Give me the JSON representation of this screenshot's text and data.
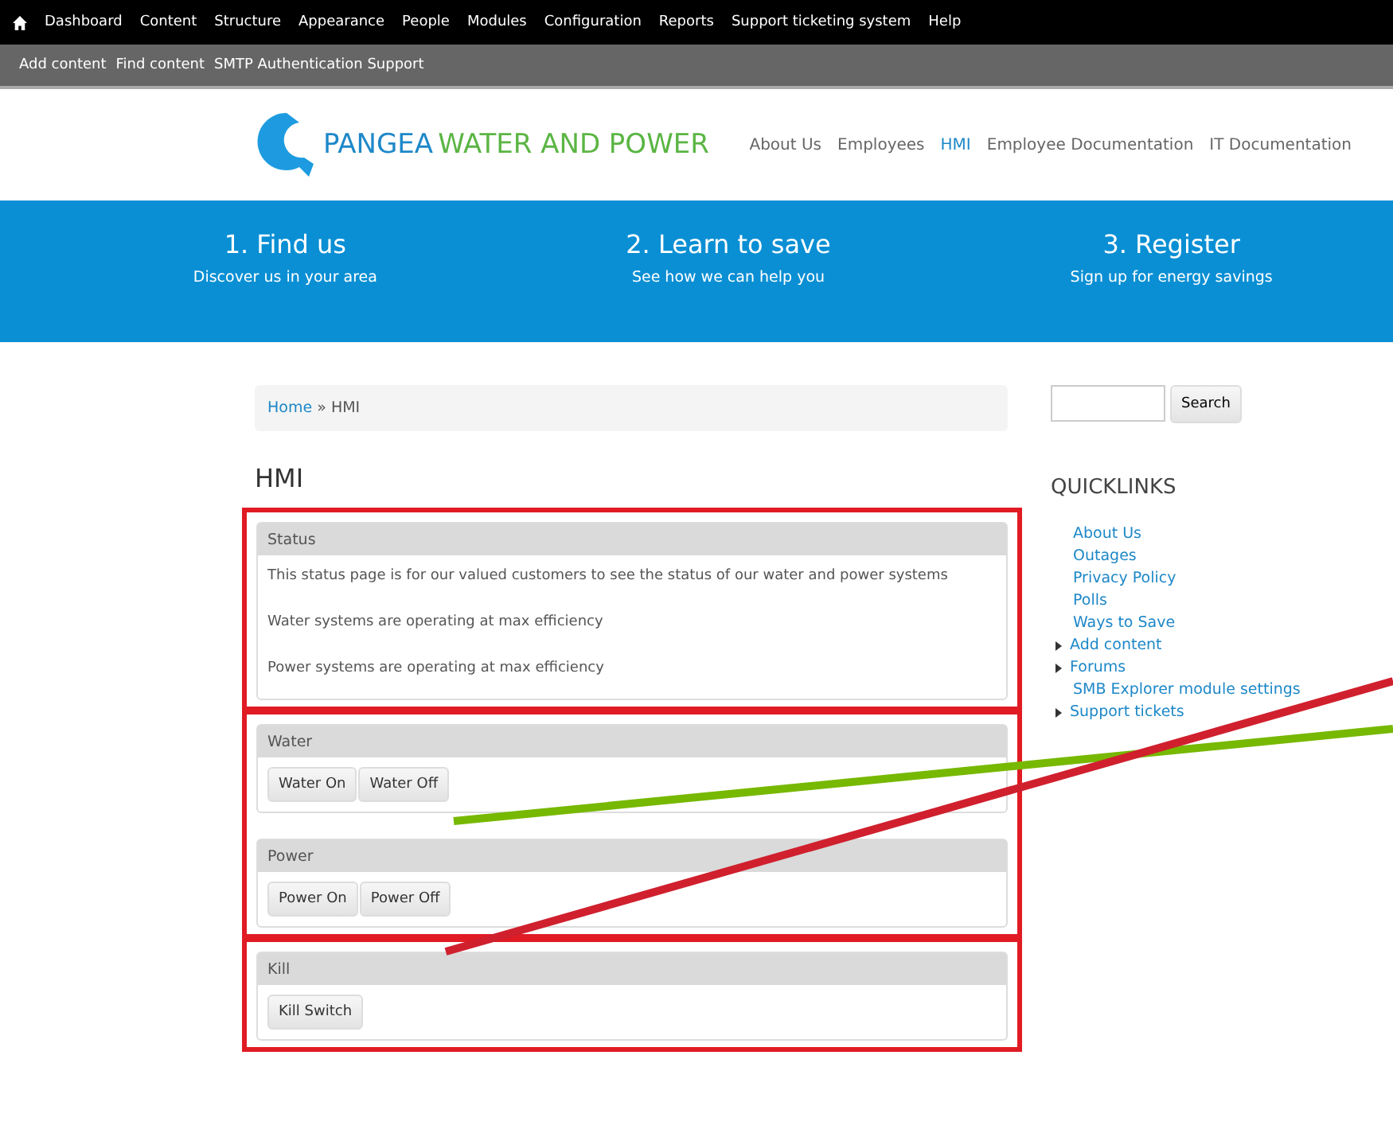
{
  "admin_toolbar": {
    "items": [
      "Dashboard",
      "Content",
      "Structure",
      "Appearance",
      "People",
      "Modules",
      "Configuration",
      "Reports",
      "Support ticketing system",
      "Help"
    ]
  },
  "shortcuts": [
    "Add content",
    "Find content",
    "SMTP Authentication Support"
  ],
  "header": {
    "logo_name": "PANGEA",
    "logo_tagline": "WATER AND POWER",
    "nav": [
      {
        "label": "About Us",
        "selected": false
      },
      {
        "label": "Employees",
        "selected": false
      },
      {
        "label": "HMI",
        "selected": true
      },
      {
        "label": "Employee Documentation",
        "selected": false
      },
      {
        "label": "IT Documentation",
        "selected": false
      }
    ]
  },
  "hero": [
    {
      "title": "1. Find us",
      "subtitle": "Discover us in your area"
    },
    {
      "title": "2. Learn to save",
      "subtitle": "See how we can help you"
    },
    {
      "title": "3. Register",
      "subtitle": "Sign up for energy savings"
    }
  ],
  "breadcrumb": {
    "link": "Home",
    "separator": "»",
    "current": "HMI"
  },
  "page_title": "HMI",
  "groups": [
    {
      "panels": [
        {
          "title": "Status",
          "kind": "text",
          "lines": [
            "This status page is for our valued customers to see the status of our water and power systems",
            "Water systems are operating at max efficiency",
            "Power systems are operating at max efficiency"
          ]
        }
      ]
    },
    {
      "panels": [
        {
          "title": "Water",
          "kind": "buttons",
          "buttons": [
            "Water On",
            "Water Off"
          ]
        },
        {
          "title": "Power",
          "kind": "buttons",
          "buttons": [
            "Power On",
            "Power Off"
          ]
        }
      ]
    },
    {
      "panels": [
        {
          "title": "Kill",
          "kind": "buttons",
          "buttons": [
            "Kill Switch"
          ]
        }
      ]
    }
  ],
  "sidebar": {
    "search_button": "Search",
    "heading": "QUICKLINKS",
    "links": [
      {
        "label": "About Us",
        "expandable": false
      },
      {
        "label": "Outages",
        "expandable": false
      },
      {
        "label": "Privacy Policy",
        "expandable": false
      },
      {
        "label": "Polls",
        "expandable": false
      },
      {
        "label": "Ways to Save",
        "expandable": false
      },
      {
        "label": "Add content",
        "expandable": true
      },
      {
        "label": "Forums",
        "expandable": true
      },
      {
        "label": "SMB Explorer module settings",
        "expandable": false
      },
      {
        "label": "Support tickets",
        "expandable": true
      }
    ]
  }
}
